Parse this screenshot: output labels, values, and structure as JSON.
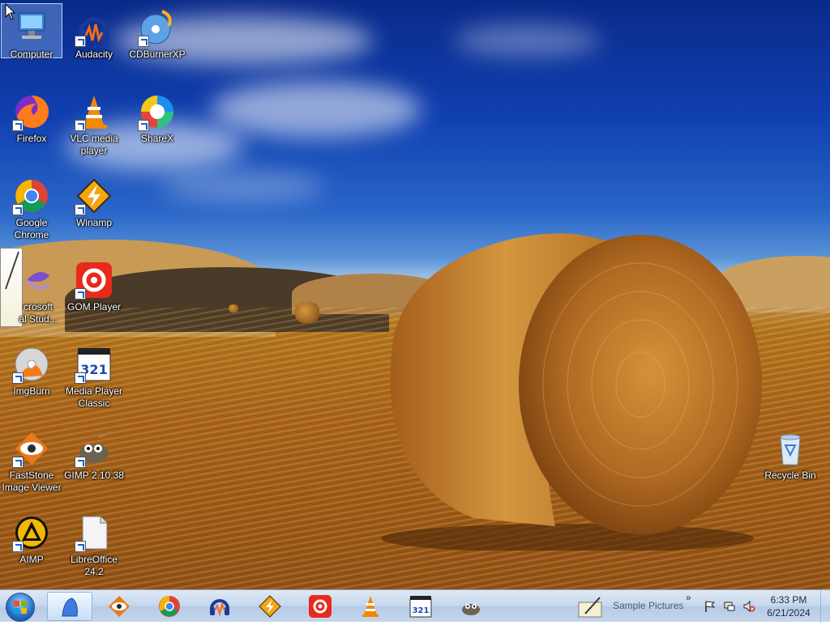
{
  "desktop": {
    "icons": [
      {
        "label": "Computer",
        "icon": "computer-icon"
      },
      {
        "label": "Audacity",
        "icon": "audacity-icon"
      },
      {
        "label": "CDBurnerXP",
        "icon": "cdburnerxp-icon"
      },
      {
        "label": "Firefox",
        "icon": "firefox-icon"
      },
      {
        "label": "VLC media\nplayer",
        "icon": "vlc-icon"
      },
      {
        "label": "ShareX",
        "icon": "sharex-icon"
      },
      {
        "label": "Google\nChrome",
        "icon": "chrome-icon"
      },
      {
        "label": "Winamp",
        "icon": "winamp-icon"
      },
      {
        "label": "crosoft\nal Stud...",
        "icon": "visual-studio-icon"
      },
      {
        "label": "GOM Player",
        "icon": "gom-player-icon"
      },
      {
        "label": "ImgBurn",
        "icon": "imgburn-icon"
      },
      {
        "label": "Media Player\nClassic",
        "icon": "media-player-classic-icon"
      },
      {
        "label": "FastStone\nImage Viewer",
        "icon": "faststone-icon"
      },
      {
        "label": "GIMP 2.10.38",
        "icon": "gimp-icon"
      },
      {
        "label": "AIMP",
        "icon": "aimp-icon"
      },
      {
        "label": "LibreOffice\n24.2",
        "icon": "libreoffice-icon"
      },
      {
        "label": "Recycle Bin",
        "icon": "recycle-bin-icon"
      }
    ]
  },
  "taskbar": {
    "start_button": "start-orb",
    "pinned": [
      "explorer-icon",
      "faststone-icon",
      "chrome-icon",
      "audacity-icon",
      "winamp-icon",
      "gom-player-icon",
      "vlc-icon",
      "media-player-classic-icon",
      "gimp-icon"
    ],
    "tray_label": "Sample Pictures",
    "tray_chevron": "»",
    "clock_time": "6:33 PM",
    "clock_date": "6/21/2024"
  },
  "colors": {
    "taskbar_top": "#dfe9f5",
    "taskbar_bottom": "#b7cbe6",
    "sky": "#1040b0",
    "field": "#b3761f"
  }
}
